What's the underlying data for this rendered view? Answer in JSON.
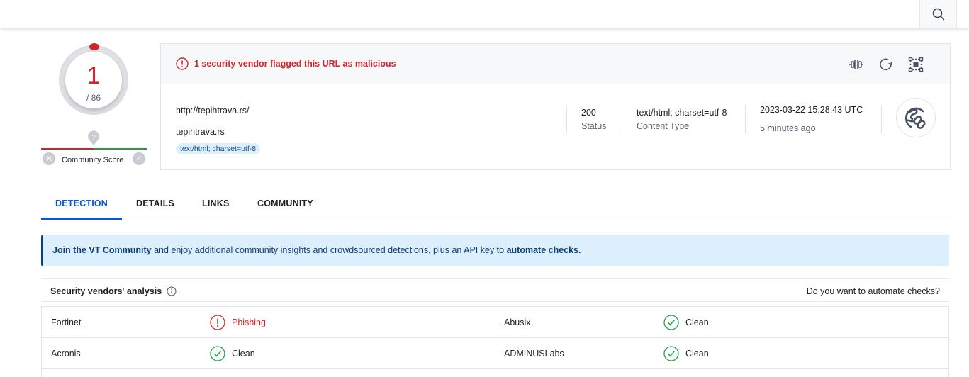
{
  "topbar": {
    "search_icon": "search-icon"
  },
  "score": {
    "detections": "1",
    "total": "/ 86",
    "community_label": "Community Score",
    "community_unknown_icon": "question-pin-icon"
  },
  "alert": {
    "icon": "alert-circle-icon",
    "text": "1 security vendor flagged this URL as malicious",
    "actions": [
      {
        "name": "compare-icon"
      },
      {
        "name": "reanalyze-icon"
      },
      {
        "name": "graph-icon"
      }
    ]
  },
  "url_info": {
    "url": "http://tepihtrava.rs/",
    "domain": "tepihtrava.rs",
    "tag": "text/html; charset=utf-8",
    "status_value": "200",
    "status_label": "Status",
    "content_type_value": "text/html; charset=utf-8",
    "content_type_label": "Content Type",
    "date": "2023-03-22 15:28:43 UTC",
    "relative_time": "5 minutes ago",
    "type_icon": "globe-link-icon"
  },
  "tabs": [
    {
      "label": "DETECTION",
      "active": true
    },
    {
      "label": "DETAILS",
      "active": false
    },
    {
      "label": "LINKS",
      "active": false
    },
    {
      "label": "COMMUNITY",
      "active": false
    }
  ],
  "banner": {
    "link1": "Join the VT Community",
    "middle": " and enjoy additional community insights and crowdsourced detections, plus an API key to ",
    "link2": "automate checks."
  },
  "vendors": {
    "title": "Security vendors' analysis",
    "automate_text": "Do you want to automate checks?",
    "rows": [
      [
        {
          "name": "Fortinet",
          "result": "Phishing",
          "status": "malicious"
        },
        {
          "name": "Abusix",
          "result": "Clean",
          "status": "clean"
        }
      ],
      [
        {
          "name": "Acronis",
          "result": "Clean",
          "status": "clean"
        },
        {
          "name": "ADMINUSLabs",
          "result": "Clean",
          "status": "clean"
        }
      ]
    ]
  },
  "colors": {
    "malicious": "#d0262b",
    "clean": "#1fa14a",
    "accent": "#0b57d0",
    "banner_bg": "#ddeefc"
  }
}
